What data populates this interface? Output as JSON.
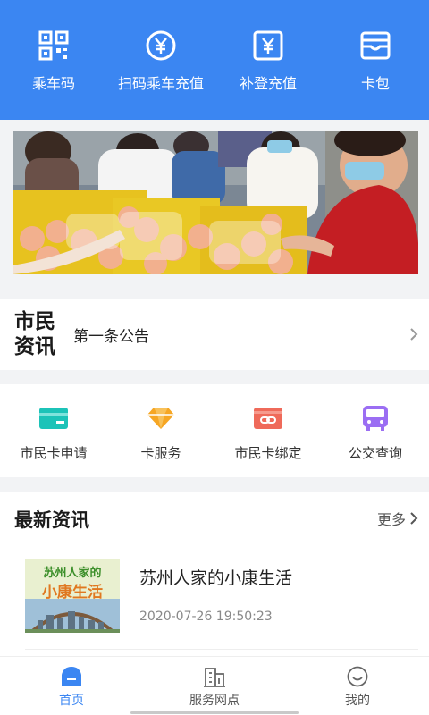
{
  "header": {
    "quick_actions": [
      {
        "label": "乘车码",
        "icon": "qr-code-icon"
      },
      {
        "label": "扫码乘车充值",
        "icon": "yuan-circle-icon"
      },
      {
        "label": "补登充值",
        "icon": "yuan-square-icon"
      },
      {
        "label": "卡包",
        "icon": "wallet-icon"
      }
    ]
  },
  "notice": {
    "title_line1": "市民",
    "title_line2": "资讯",
    "content": "第一条公告"
  },
  "services": [
    {
      "label": "市民卡申请",
      "icon": "card-icon"
    },
    {
      "label": "卡服务",
      "icon": "diamond-icon"
    },
    {
      "label": "市民卡绑定",
      "icon": "link-card-icon"
    },
    {
      "label": "公交查询",
      "icon": "bus-icon"
    }
  ],
  "news": {
    "heading": "最新资讯",
    "more_label": "更多",
    "items": [
      {
        "title": "苏州人家的小康生活",
        "time": "2020-07-26 19:50:23",
        "thumb_line1": "苏州人家的",
        "thumb_line2": "小康生活"
      }
    ]
  },
  "bottom_nav": [
    {
      "label": "首页",
      "icon": "home-icon",
      "active": true
    },
    {
      "label": "服务网点",
      "icon": "building-icon",
      "active": false
    },
    {
      "label": "我的",
      "icon": "smile-icon",
      "active": false
    }
  ],
  "colors": {
    "primary": "#3b86f2",
    "card_teal": "#1cc3b8",
    "diamond_orange": "#f6a623",
    "link_red": "#ef6a5a",
    "bus_purple": "#9b6ef3",
    "thumb_green": "#3c8f2a",
    "thumb_orange": "#e07820"
  }
}
